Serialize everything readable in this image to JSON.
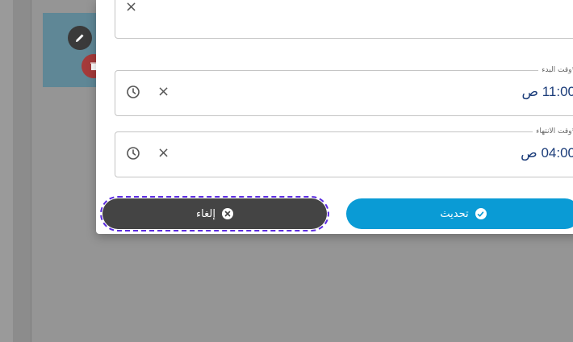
{
  "form": {
    "start_time": {
      "label": "وقت البدء*",
      "value": "11:00 ص"
    },
    "end_time": {
      "label": "وقت الانتهاء*",
      "value": "04:00 ص"
    }
  },
  "icons": {
    "clear": "×",
    "clock": "clock-icon"
  },
  "buttons": {
    "cancel_label": "إلغاء",
    "update_label": "تحديث"
  },
  "colors": {
    "cancel": "#444444",
    "update": "#0a9bd5",
    "time_value": "#1c3d7a",
    "focus_outline": "#5b2be0"
  }
}
